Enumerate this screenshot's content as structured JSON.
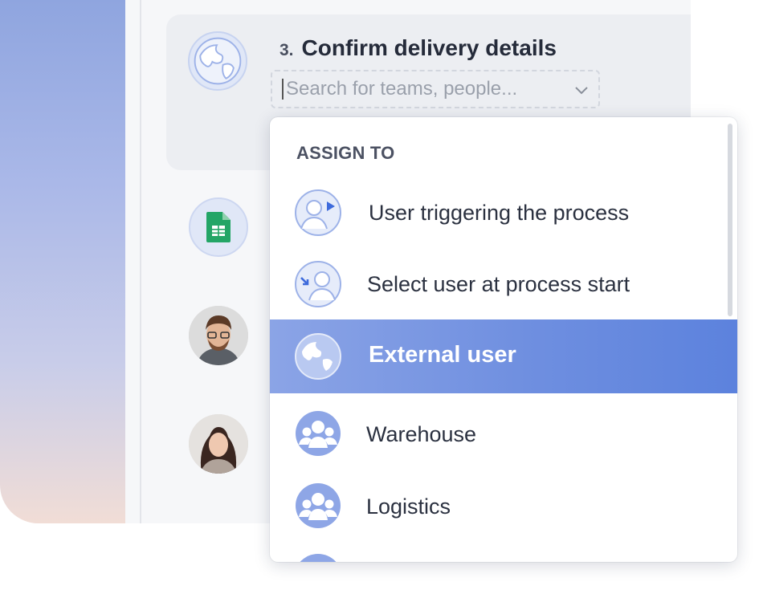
{
  "step": {
    "number": "3.",
    "title": "Confirm delivery details"
  },
  "search": {
    "placeholder": "Search for teams, people..."
  },
  "dropdown": {
    "header": "ASSIGN TO",
    "items": [
      {
        "label": "User triggering the process",
        "icon": "user-play-icon"
      },
      {
        "label": "Select user at process start",
        "icon": "user-select-icon"
      },
      {
        "label": "External user",
        "icon": "globe-icon",
        "selected": true
      },
      {
        "label": "Warehouse",
        "icon": "group-icon"
      },
      {
        "label": "Logistics",
        "icon": "group-icon"
      }
    ]
  },
  "colors": {
    "accent": "#6f8fe0",
    "icon_blue": "#8ea6e6",
    "sheet_green": "#23a566"
  }
}
